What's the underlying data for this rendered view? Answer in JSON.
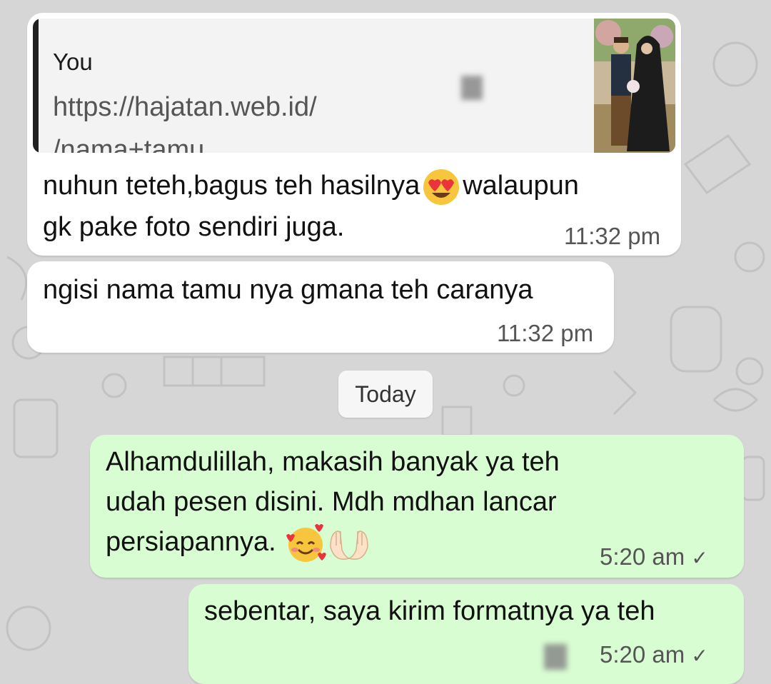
{
  "quoted": {
    "author": "You",
    "link_line1": "https://hajatan.web.id/",
    "link_line2": "/nama+tamu"
  },
  "messages": [
    {
      "id": "m1",
      "direction": "incoming",
      "line1": "nuhun teteh,bagus teh hasilnya",
      "line1_after": "walaupun",
      "line2": "gk pake foto sendiri juga.",
      "time": "11:32 pm"
    },
    {
      "id": "m2",
      "direction": "incoming",
      "text": "ngisi nama tamu nya gmana teh caranya",
      "time": "11:32 pm"
    },
    {
      "id": "m3",
      "direction": "outgoing",
      "line1": "Alhamdulillah, makasih banyak ya teh",
      "line2": "udah pesen disini. Mdh mdhan lancar",
      "line3": "persiapannya.",
      "time": "5:20 am",
      "check": "✓"
    },
    {
      "id": "m4",
      "direction": "outgoing",
      "text": "sebentar,  saya kirim formatnya ya teh",
      "time": "5:20 am",
      "check": "✓"
    }
  ],
  "date_divider": "Today",
  "icons": {
    "heart_eyes": "heart-eyes-emoji",
    "smiling_hearts": "smiling-face-with-hearts-emoji",
    "raised_hands": "palms-up-together-emoji",
    "read_check": "check-icon"
  },
  "colors": {
    "incoming_bubble": "#ffffff",
    "outgoing_bubble": "#d9fdd3",
    "background": "#d6d6d6"
  }
}
